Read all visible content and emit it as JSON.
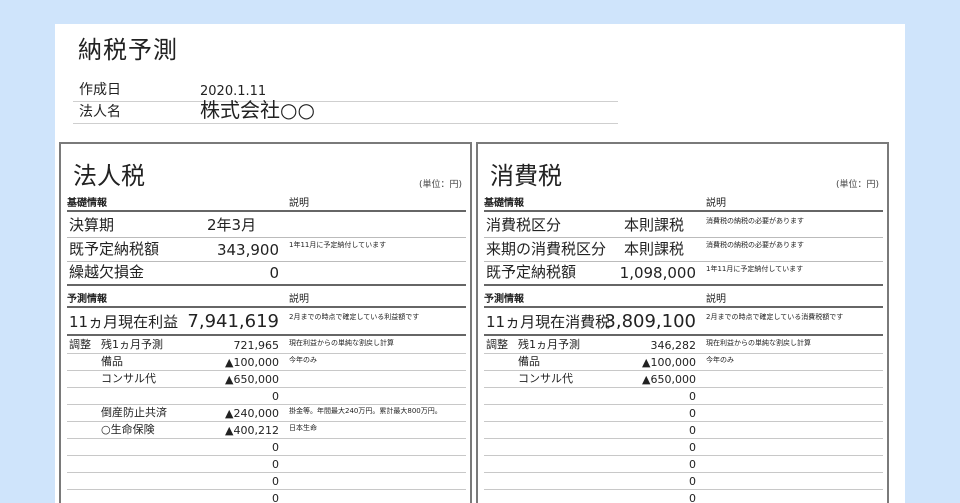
{
  "doc": {
    "title": "納税予測",
    "created_label": "作成日",
    "created_value": "2020.1.11",
    "company_label": "法人名",
    "company_value": "株式会社○○"
  },
  "corporate": {
    "title": "法人税",
    "unit": "(単位：円)",
    "basic_header": "基礎情報",
    "desc_header": "説明",
    "basic_rows": [
      {
        "label": "決算期",
        "value": "2年3月",
        "note": ""
      },
      {
        "label": "既予定納税額",
        "value": "343,900",
        "note": "1年11月に予定納付しています"
      },
      {
        "label": "繰越欠損金",
        "value": "0",
        "note": ""
      }
    ],
    "forecast_header": "予測情報",
    "forecast_desc_header": "説明",
    "current_label": "11ヵ月現在利益",
    "current_value": "7,941,619",
    "current_note": "2月までの時点で確定している利益額です",
    "adjust_label": "調整",
    "adjust_rows": [
      {
        "label": "残1ヵ月予測",
        "value": "721,965",
        "note": "現在利益からの単純な割戻し計算"
      },
      {
        "label": "備品",
        "value": "▲100,000",
        "note": "今年のみ"
      },
      {
        "label": "コンサル代",
        "value": "▲650,000",
        "note": ""
      },
      {
        "label": "",
        "value": "0",
        "note": ""
      },
      {
        "label": "倒産防止共済",
        "value": "▲240,000",
        "note": "掛金等。年間最大240万円。累計最大800万円。"
      },
      {
        "label": "○生命保険",
        "value": "▲400,212",
        "note": "日本生命"
      },
      {
        "label": "",
        "value": "0",
        "note": ""
      },
      {
        "label": "",
        "value": "0",
        "note": ""
      },
      {
        "label": "",
        "value": "0",
        "note": ""
      },
      {
        "label": "",
        "value": "0",
        "note": ""
      }
    ]
  },
  "consumption": {
    "title": "消費税",
    "unit": "(単位：円)",
    "basic_header": "基礎情報",
    "desc_header": "説明",
    "basic_rows": [
      {
        "label": "消費税区分",
        "value": "本則課税",
        "note": "消費税の納税の必要があります"
      },
      {
        "label": "来期の消費税区分",
        "value": "本則課税",
        "note": "消費税の納税の必要があります"
      },
      {
        "label": "既予定納税額",
        "value": "1,098,000",
        "note": "1年11月に予定納付しています"
      }
    ],
    "forecast_header": "予測情報",
    "forecast_desc_header": "説明",
    "current_label": "11ヵ月現在消費税",
    "current_value": "3,809,100",
    "current_note": "2月までの時点で確定している消費税額です",
    "adjust_label": "調整",
    "adjust_rows": [
      {
        "label": "残1ヵ月予測",
        "value": "346,282",
        "note": "現在利益からの単純な割戻し計算"
      },
      {
        "label": "備品",
        "value": "▲100,000",
        "note": "今年のみ"
      },
      {
        "label": "コンサル代",
        "value": "▲650,000",
        "note": ""
      },
      {
        "label": "",
        "value": "0",
        "note": ""
      },
      {
        "label": "",
        "value": "0",
        "note": ""
      },
      {
        "label": "",
        "value": "0",
        "note": ""
      },
      {
        "label": "",
        "value": "0",
        "note": ""
      },
      {
        "label": "",
        "value": "0",
        "note": ""
      },
      {
        "label": "",
        "value": "0",
        "note": ""
      },
      {
        "label": "",
        "value": "0",
        "note": ""
      }
    ]
  }
}
